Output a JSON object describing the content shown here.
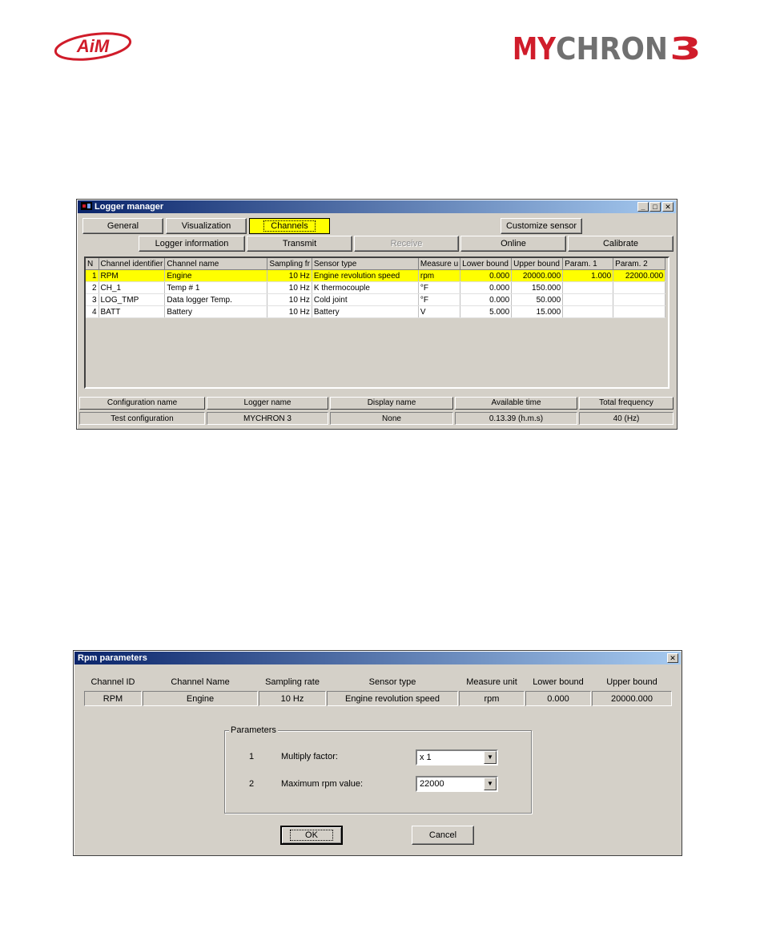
{
  "branding": {
    "left_logo": "AiM",
    "right_logo": "MYCHRON3"
  },
  "colors": {
    "titlebar_start": "#0a246a",
    "titlebar_end": "#a6caf0",
    "selection": "#ffff00",
    "window_bg": "#d4d0c8",
    "aim_red": "#d01c2a"
  },
  "logger_window": {
    "title": "Logger manager",
    "tabs": [
      "General",
      "Visualization",
      "Channels"
    ],
    "active_tab": "Channels",
    "customize_label": "Customize sensor",
    "actions": [
      "Logger information",
      "Transmit",
      "Receive",
      "Online",
      "Calibrate"
    ],
    "disabled_action": "Receive",
    "columns": [
      "N",
      "Channel identifier",
      "Channel name",
      "Sampling fr",
      "Sensor type",
      "Measure u",
      "Lower bound",
      "Upper bound",
      "Param. 1",
      "Param. 2"
    ],
    "rows": [
      [
        "1",
        "RPM",
        "Engine",
        "10 Hz",
        "Engine revolution speed",
        "rpm",
        "0.000",
        "20000.000",
        "1.000",
        "22000.000"
      ],
      [
        "2",
        "CH_1",
        "Temp # 1",
        "10 Hz",
        "K thermocouple",
        "°F",
        "0.000",
        "150.000",
        "",
        ""
      ],
      [
        "3",
        "LOG_TMP",
        "Data logger Temp.",
        "10 Hz",
        "Cold joint",
        "°F",
        "0.000",
        "50.000",
        "",
        ""
      ],
      [
        "4",
        "BATT",
        "Battery",
        "10 Hz",
        "Battery",
        "V",
        "5.000",
        "15.000",
        "",
        ""
      ]
    ],
    "selected_row": 0,
    "info_headers": [
      "Configuration name",
      "Logger name",
      "Display name",
      "Available time",
      "Total frequency"
    ],
    "info_values": [
      "Test configuration",
      "MYCHRON 3",
      "None",
      "0.13.39 (h.m.s)",
      "40 (Hz)"
    ]
  },
  "rpm_dialog": {
    "title": "Rpm parameters",
    "headers": [
      "Channel ID",
      "Channel Name",
      "Sampling rate",
      "Sensor type",
      "Measure unit",
      "Lower bound",
      "Upper bound"
    ],
    "values": [
      "RPM",
      "Engine",
      "10 Hz",
      "Engine revolution speed",
      "rpm",
      "0.000",
      "20000.000"
    ],
    "group_label": "Parameters",
    "params": [
      {
        "index": "1",
        "label": "Multiply factor:",
        "value": "x 1"
      },
      {
        "index": "2",
        "label": "Maximum rpm value:",
        "value": "22000"
      }
    ],
    "ok_label": "OK",
    "cancel_label": "Cancel"
  }
}
